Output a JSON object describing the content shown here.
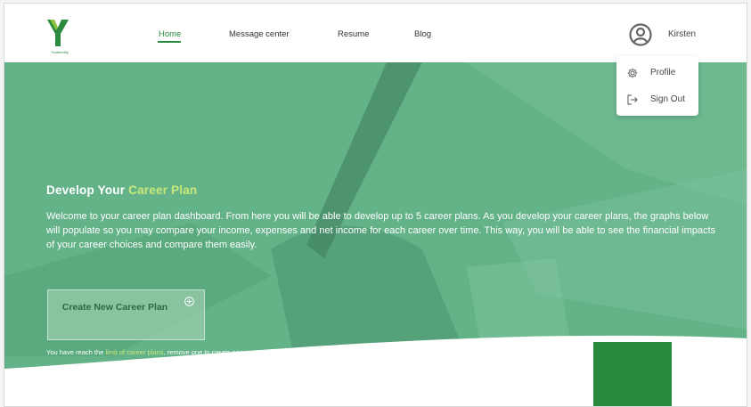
{
  "header": {
    "logo_text": "Youthentity",
    "nav": [
      {
        "label": "Home",
        "active": true
      },
      {
        "label": "Message center"
      },
      {
        "label": "Resume"
      },
      {
        "label": "Blog"
      }
    ],
    "user": {
      "name": "Kirsten",
      "icon": "user-circle-icon"
    }
  },
  "user_menu": {
    "items": [
      {
        "label": "Profile",
        "icon": "gear-icon"
      },
      {
        "label": "Sign Out",
        "icon": "sign-out-icon"
      }
    ]
  },
  "hero": {
    "title_prefix": "Develop Your ",
    "title_accent": "Career Plan",
    "text": "Welcome to your career plan dashboard. From here you will be able to develop up to 5 career plans. As you develop your career plans, the graphs below will populate so you may compare your income, expenses and net income for each career over time. This way, you will be able to see the financial impacts of your career choices and compare them easily.",
    "create_button": "Create New Career Plan",
    "create_icon": "plus-circle-icon",
    "limit_prefix": "You have reach the ",
    "limit_link": "limit of career plans",
    "limit_suffix": ", remove one to create new."
  },
  "colors": {
    "brand_green": "#2a8a3e",
    "accent_lime": "#c9e87a",
    "hero_overlay": "#5fae84"
  }
}
